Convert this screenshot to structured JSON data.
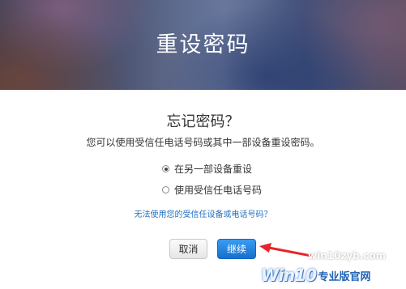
{
  "banner": {
    "title": "重设密码"
  },
  "main": {
    "heading": "忘记密码？",
    "subtitle": "您可以使用受信任电话号码或其中一部设备重设密码。",
    "options": [
      {
        "label": "在另一部设备重设",
        "checked": true
      },
      {
        "label": "使用受信任电话号码",
        "checked": false
      }
    ],
    "help_link": "无法使用您的受信任设备或电话号码？"
  },
  "buttons": {
    "cancel": "取消",
    "continue": "继续"
  },
  "watermark": {
    "url": "win10zyb.com",
    "brand": "Win10",
    "brand_sub": "专业版官网"
  },
  "colors": {
    "accent": "#1470cf",
    "link": "#1f6fbf",
    "arrow": "#e8232a"
  }
}
